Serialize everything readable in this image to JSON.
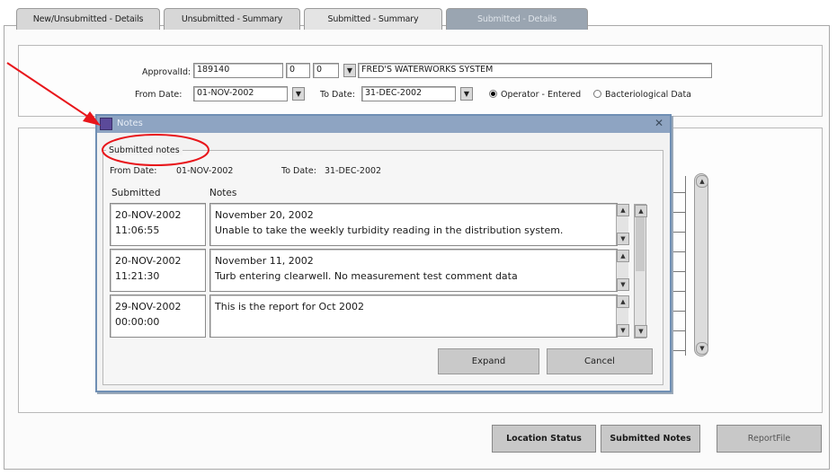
{
  "tabs": [
    {
      "label": "New/Unsubmitted - Details"
    },
    {
      "label": "Unsubmitted - Summary"
    },
    {
      "label": "Submitted - Summary"
    },
    {
      "label": "Submitted - Details"
    }
  ],
  "form": {
    "approval_label": "ApprovalId:",
    "approval_id": "189140",
    "field2": "0",
    "field3": "0",
    "system_name": "FRED'S WATERWORKS SYSTEM",
    "from_date_label": "From Date:",
    "from_date": "01-NOV-2002",
    "to_date_label": "To Date:",
    "to_date": "31-DEC-2002",
    "radio_operator": "Operator - Entered",
    "radio_bacterio": "Bacteriological Data"
  },
  "bottom_buttons": {
    "location_status": "Location Status",
    "submitted_notes": "Submitted Notes",
    "report_file": "ReportFile"
  },
  "dialog": {
    "title": "Notes",
    "close": "✕",
    "group_label": "Submitted notes",
    "from_label": "From Date:",
    "from_value": "01-NOV-2002",
    "to_label": "To Date:",
    "to_value": "31-DEC-2002",
    "col_submitted": "Submitted",
    "col_notes": "Notes",
    "rows": [
      {
        "date": "20-NOV-2002",
        "time": "11:06:55",
        "line1": "November 20, 2002",
        "line2": "Unable to take the weekly turbidity reading in the distribution system."
      },
      {
        "date": "20-NOV-2002",
        "time": "11:21:30",
        "line1": "November 11, 2002",
        "line2": "Turb entering clearwell.  No measurement test comment data"
      },
      {
        "date": "29-NOV-2002",
        "time": "00:00:00",
        "line1": "This is the report for Oct 2002",
        "line2": ""
      }
    ],
    "expand": "Expand",
    "cancel": "Cancel"
  },
  "colors": {
    "annotation": "#e8161b",
    "dialog_title_bar": "#8ea4c2"
  }
}
